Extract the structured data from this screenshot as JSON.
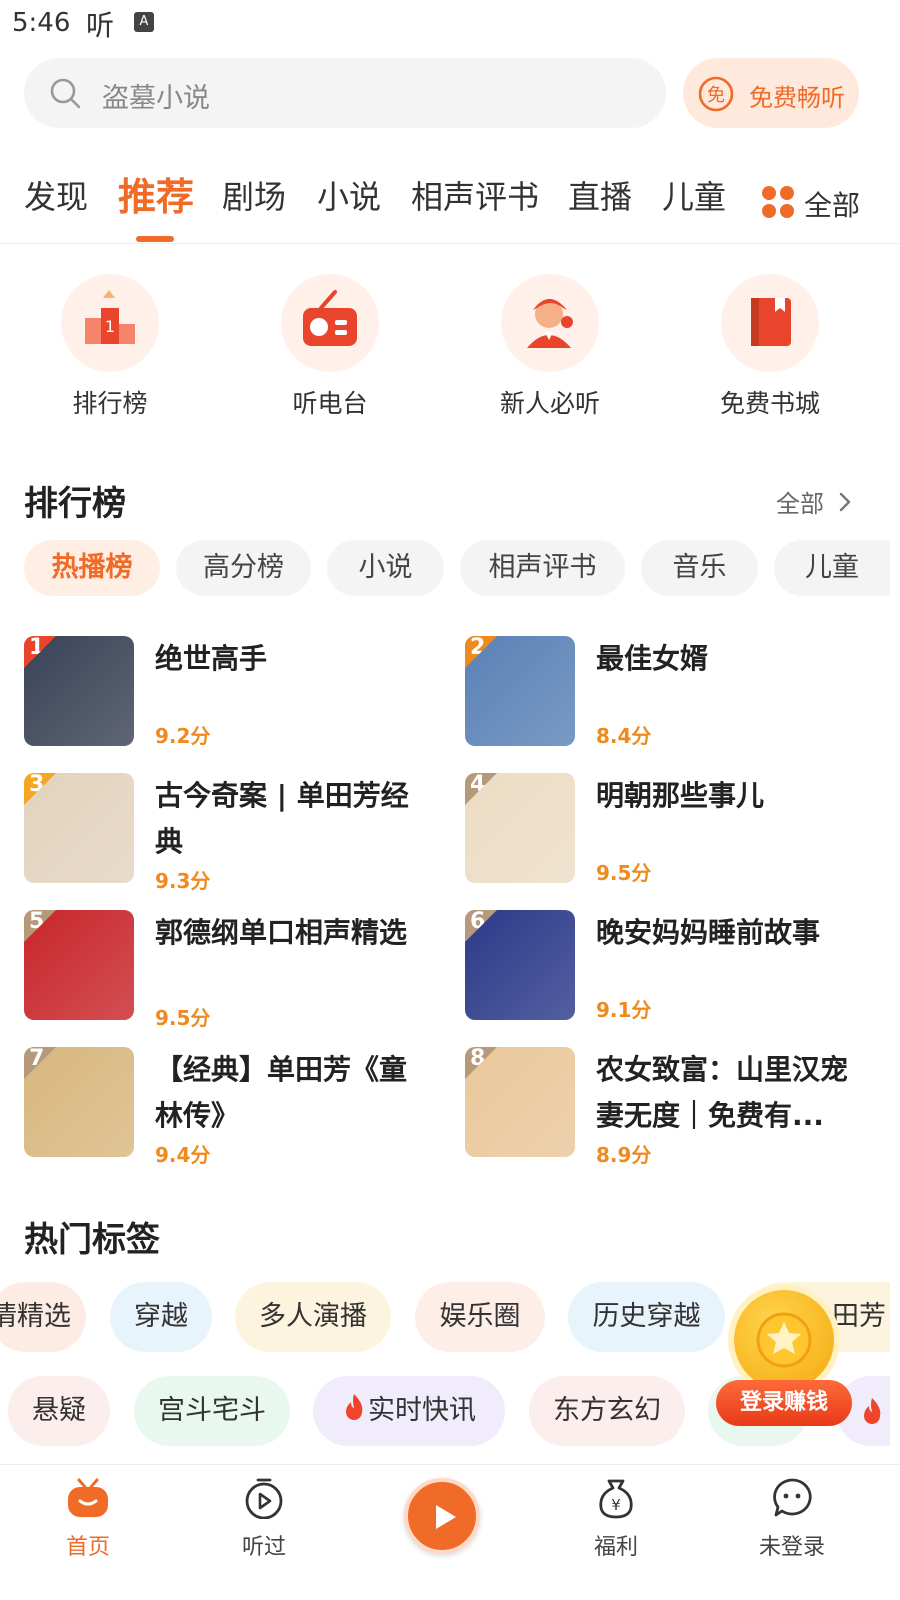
{
  "status": {
    "time": "5:46",
    "app_glyph": "听",
    "badge": "A"
  },
  "search": {
    "placeholder": "盗墓小说",
    "icon": "search-icon"
  },
  "free_listen": {
    "label": "免费畅听",
    "icon_glyph": "免"
  },
  "tabs": [
    {
      "label": "发现"
    },
    {
      "label": "推荐",
      "active": true
    },
    {
      "label": "剧场"
    },
    {
      "label": "小说"
    },
    {
      "label": "相声评书"
    },
    {
      "label": "直播"
    },
    {
      "label": "儿童"
    }
  ],
  "tab_all": {
    "label": "全部"
  },
  "quick": [
    {
      "label": "排行榜",
      "icon": "rank-icon"
    },
    {
      "label": "听电台",
      "icon": "radio-icon"
    },
    {
      "label": "新人必听",
      "icon": "newbie-icon"
    },
    {
      "label": "免费书城",
      "icon": "book-icon"
    }
  ],
  "ranking": {
    "title": "排行榜",
    "more": "全部",
    "chips": [
      {
        "label": "热播榜",
        "active": true
      },
      {
        "label": "高分榜"
      },
      {
        "label": "小说"
      },
      {
        "label": "相声评书"
      },
      {
        "label": "音乐"
      },
      {
        "label": "儿童"
      }
    ],
    "items": [
      {
        "rank": "1",
        "title": "绝世高手",
        "score": "9.2分",
        "badge_color": "#e8452c",
        "cover_color": "#3a4256"
      },
      {
        "rank": "2",
        "title": "最佳女婿",
        "score": "8.4分",
        "badge_color": "#f08a1c",
        "cover_color": "#5a82b6"
      },
      {
        "rank": "3",
        "title": "古今奇案 | 单田芳经典",
        "score": "9.3分",
        "badge_color": "#f5a623",
        "cover_color": "#e2d3bd"
      },
      {
        "rank": "4",
        "title": "明朝那些事儿",
        "score": "9.5分",
        "badge_color": "#b6987a",
        "cover_color": "#ecdcc4"
      },
      {
        "rank": "5",
        "title": "郭德纲单口相声精选",
        "score": "9.5分",
        "badge_color": "#b6987a",
        "cover_color": "#c8262a"
      },
      {
        "rank": "6",
        "title": "晚安妈妈睡前故事",
        "score": "9.1分",
        "badge_color": "#b6987a",
        "cover_color": "#2b3a8a"
      },
      {
        "rank": "7",
        "title": "【经典】单田芳《童林传》",
        "score": "9.4分",
        "badge_color": "#b6987a",
        "cover_color": "#d8b77e"
      },
      {
        "rank": "8",
        "title": "农女致富：山里汉宠妻无度｜免费有...",
        "score": "8.9分",
        "badge_color": "#b6987a",
        "cover_color": "#e9c79a"
      }
    ]
  },
  "hot_tags": {
    "title": "热门标签",
    "row1": [
      {
        "label": "情精选",
        "bg": "#fdece4",
        "fg": "#333"
      },
      {
        "label": "穿越",
        "bg": "#e8f4fb",
        "fg": "#333"
      },
      {
        "label": "多人演播",
        "bg": "#fdf4e0",
        "fg": "#333"
      },
      {
        "label": "娱乐圈",
        "bg": "#fdeee8",
        "fg": "#333"
      },
      {
        "label": "历史穿越",
        "bg": "#e8f4fb",
        "fg": "#333"
      },
      {
        "label": "田芳",
        "bg": "#fdf4e0",
        "fg": "#333"
      }
    ],
    "row2": [
      {
        "label": "悬疑",
        "bg": "#fdeeee",
        "fg": "#333"
      },
      {
        "label": "宫斗宅斗",
        "bg": "#e9f8ee",
        "fg": "#333"
      },
      {
        "label": "实时快讯",
        "bg": "#f1ecfb",
        "fg": "#333"
      },
      {
        "label": "东方玄幻",
        "bg": "#fdeeee",
        "fg": "#333"
      }
    ]
  },
  "earn": {
    "label": "登录赚钱"
  },
  "nav": [
    {
      "label": "首页",
      "active": true,
      "icon": "home-icon"
    },
    {
      "label": "听过",
      "icon": "history-icon"
    },
    {
      "label": "福利",
      "icon": "welfare-icon"
    },
    {
      "label": "未登录",
      "icon": "profile-icon"
    }
  ],
  "colors": {
    "accent": "#f06a28",
    "score": "#f08a1c"
  }
}
